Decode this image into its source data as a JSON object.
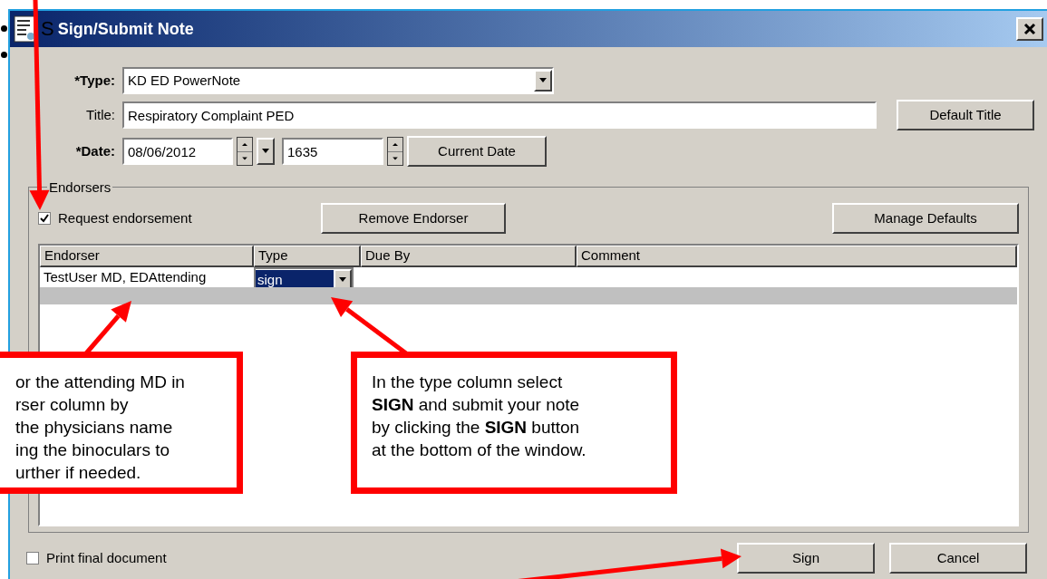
{
  "slide_bullet_text": "S",
  "window": {
    "title": "Sign/Submit Note"
  },
  "form": {
    "type_label": "*Type:",
    "type_value": "KD ED PowerNote",
    "title_label": "Title:",
    "title_value": "Respiratory Complaint PED",
    "date_label": "*Date:",
    "date_value": "08/06/2012",
    "time_value": "1635",
    "default_title_button": "Default Title",
    "current_date_button": "Current Date"
  },
  "endorsers": {
    "legend": "Endorsers",
    "request_endorsement": {
      "label": "Request endorsement",
      "checked": true
    },
    "remove_button": "Remove Endorser",
    "manage_button": "Manage Defaults",
    "columns": [
      "Endorser",
      "Type",
      "Due By",
      "Comment"
    ],
    "rows": [
      {
        "endorser": "TestUser MD, EDAttending",
        "type": "sign",
        "selected": true
      }
    ]
  },
  "print_final": {
    "label": "Print final document",
    "checked": false
  },
  "buttons": [
    {
      "label": "Sign"
    },
    {
      "label": "Cancel"
    }
  ],
  "callouts": [
    {
      "lines": [
        "or the attending MD in",
        "rser column by",
        "the physicians name",
        "ing the binoculars to",
        "urther if needed."
      ]
    },
    {
      "lines": [
        "In the type column select",
        "**SIGN** and submit your note",
        "by clicking the **SIGN** button",
        "at the bottom of the window."
      ]
    }
  ]
}
